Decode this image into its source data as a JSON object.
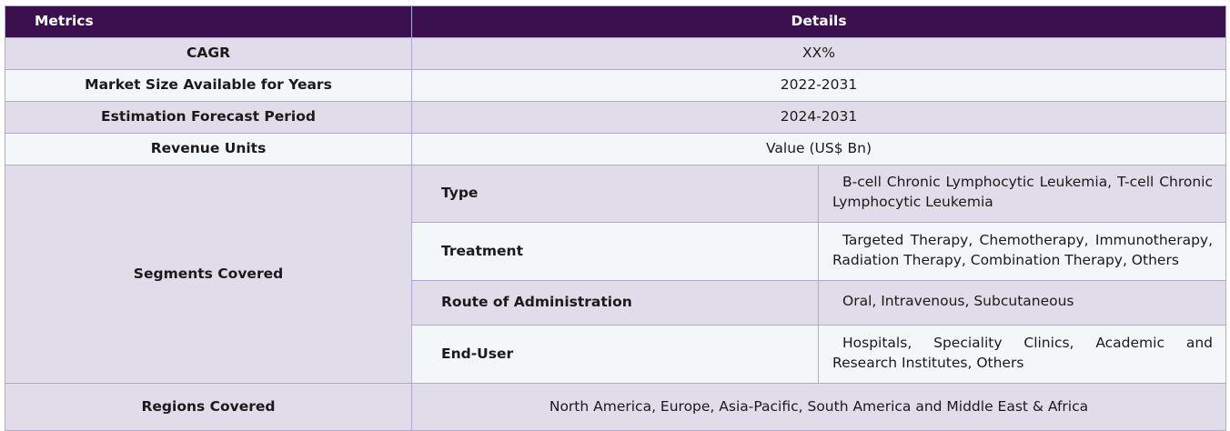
{
  "table": {
    "headers": {
      "metrics": "Metrics",
      "details": "Details"
    },
    "rows": [
      {
        "label": "CAGR",
        "value": "XX%"
      },
      {
        "label": "Market Size Available for Years",
        "value": "2022-2031"
      },
      {
        "label": "Estimation Forecast Period",
        "value": "2024-2031"
      },
      {
        "label": "Revenue Units",
        "value": "Value (US$ Bn)"
      }
    ],
    "segments": {
      "label": "Segments Covered",
      "items": [
        {
          "label": "Type",
          "value": "B-cell Chronic Lymphocytic Leukemia, T-cell Chronic Lymphocytic Leukemia"
        },
        {
          "label": "Treatment",
          "value": "Targeted Therapy, Chemotherapy, Immunotherapy, Radiation Therapy, Combination Therapy, Others"
        },
        {
          "label": "Route of Administration",
          "value": "Oral, Intravenous, Subcutaneous"
        },
        {
          "label": "End-User",
          "value": "Hospitals, Speciality Clinics, Academic and Research Institutes, Others"
        }
      ]
    },
    "regions": {
      "label": "Regions Covered",
      "value": "North America, Europe, Asia-Pacific, South America and Middle East & Africa"
    }
  }
}
